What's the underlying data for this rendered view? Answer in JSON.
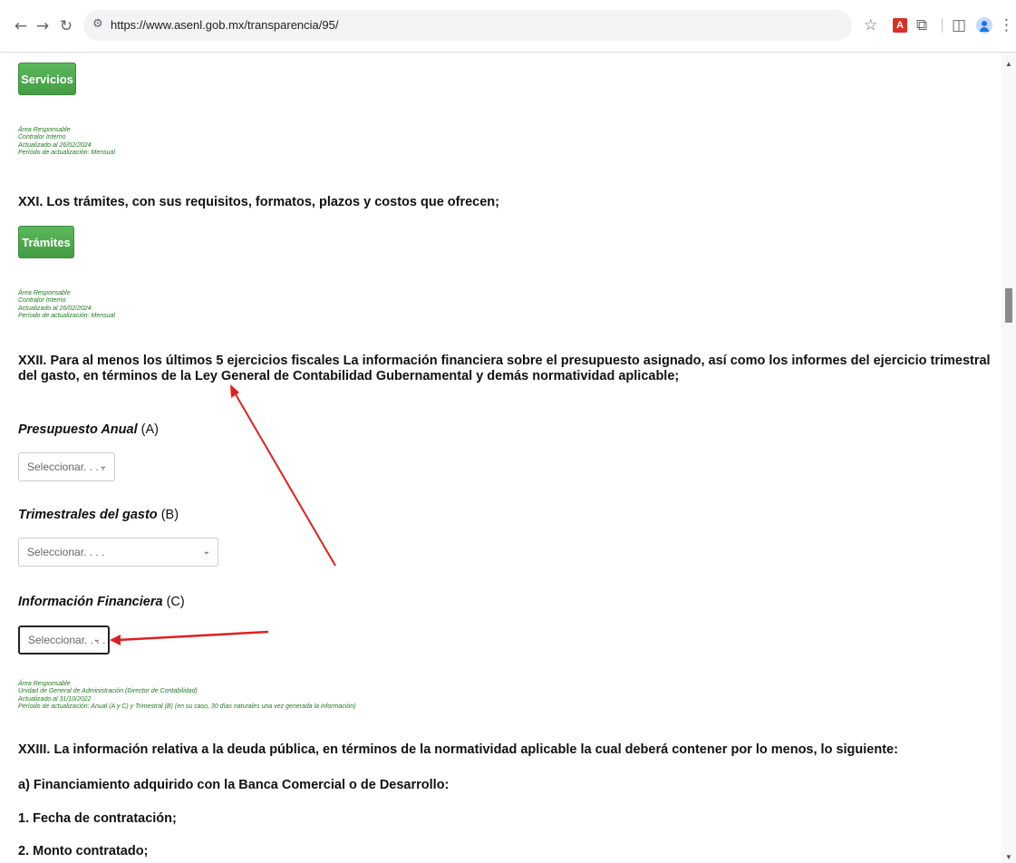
{
  "browser": {
    "url": "https://www.asenl.gob.mx/transparencia/95/",
    "icons": [
      "back-icon",
      "forward-icon",
      "reload-icon",
      "site-settings-icon",
      "star-icon",
      "pdf-extension-icon",
      "extensions-icon",
      "side-panel-icon",
      "profile-icon",
      "menu-icon"
    ]
  },
  "section_xx": {
    "button_label": "Servicios",
    "meta": {
      "area": "Área Responsable",
      "unit": "Contralor Interno",
      "updated": "Actualizado al 26/02/2024",
      "period": "Período de actualización: Mensual"
    }
  },
  "section_xxi": {
    "heading": "XXI. Los trámites, con sus requisitos, formatos, plazos y costos que ofrecen;",
    "button_label": "Trámites",
    "meta": {
      "area": "Área Responsable",
      "unit": "Contralor Interno",
      "updated": "Actualizado al 26/02/2024",
      "period": "Período de actualización: Mensual"
    }
  },
  "section_xxii": {
    "heading": "XXII. Para al menos los últimos 5 ejercicios fiscales La información financiera sobre el presupuesto asignado, así como los informes del ejercicio trimestral del gasto, en términos de la Ley General de Contabilidad Gubernamental y demás normatividad aplicable;",
    "groups": [
      {
        "label_italic": "Presupuesto Anual",
        "label_suffix": " (A)",
        "select_value": "Seleccionar. . . ."
      },
      {
        "label_italic": "Trimestrales del gasto",
        "label_suffix": " (B)",
        "select_value": "Seleccionar. . . ."
      },
      {
        "label_italic": "Información Financiera",
        "label_suffix": " (C)",
        "select_value": "Seleccionar. . . ."
      }
    ],
    "meta": {
      "area": "Área Responsable",
      "unit": "Unidad de General de Administración (Director de Contabilidad)",
      "updated": "Actualizado al 31/10/2022",
      "period": "Período de actualización: Anual (A y C) y Trimestral (B) (en su caso, 30 días naturales una vez generada la información)"
    }
  },
  "section_xxiii": {
    "heading": "XXIII. La información relativa a la deuda pública, en términos de la normatividad aplicable la cual deberá contener por lo menos, lo siguiente:",
    "items": [
      "a) Financiamiento adquirido con la Banca Comercial o de Desarrollo:",
      "1. Fecha de contratación;",
      "2. Monto contratado;"
    ]
  },
  "colors": {
    "button_green": "#5cb85c",
    "meta_green": "#1e7b1e",
    "annotation_red": "#e02020"
  }
}
